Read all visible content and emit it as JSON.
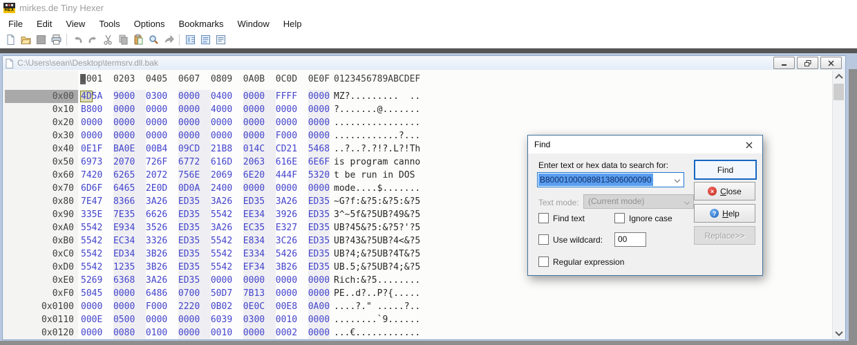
{
  "window": {
    "title": "mirkes.de Tiny Hexer",
    "app_icon": "hex-logo"
  },
  "menu": {
    "items": [
      "File",
      "Edit",
      "View",
      "Tools",
      "Options",
      "Bookmarks",
      "Window",
      "Help"
    ]
  },
  "toolbar": {
    "items": [
      {
        "name": "new-document",
        "interactable": true
      },
      {
        "name": "open-folder",
        "interactable": true
      },
      {
        "name": "save",
        "disabled": true,
        "interactable": false
      },
      {
        "name": "print",
        "interactable": true
      },
      {
        "sep": true
      },
      {
        "name": "undo",
        "disabled": true,
        "interactable": false
      },
      {
        "name": "redo",
        "disabled": true,
        "interactable": false
      },
      {
        "name": "cut",
        "disabled": true,
        "interactable": false
      },
      {
        "name": "copy",
        "disabled": true,
        "interactable": false
      },
      {
        "name": "paste",
        "interactable": true
      },
      {
        "name": "search",
        "interactable": true
      },
      {
        "name": "goto",
        "disabled": true,
        "interactable": false
      },
      {
        "sep": true
      },
      {
        "name": "bookmarks-panel",
        "interactable": true
      },
      {
        "name": "disk-window",
        "interactable": true
      },
      {
        "name": "script-list",
        "interactable": true
      }
    ]
  },
  "document": {
    "path": "C:\\Users\\sean\\Desktop\\termsrv.dll.bak",
    "window_buttons": [
      "minimize",
      "restore",
      "close"
    ]
  },
  "hex_view": {
    "column_header": "0001  0203  0405  0607  0809  0A0B  0C0D  0E0F",
    "ascii_header": "0123456789ABCDEF",
    "rows": [
      {
        "addr": "0x00",
        "selected": true,
        "cursor": "4D",
        "hex": "5A  9000  0300  0000  0400  0000  FFFF  0000",
        "ascii": "MZ?.........  .."
      },
      {
        "addr": "0x10",
        "hex": "B800  0000  0000  0000  4000  0000  0000  0000",
        "ascii": "?.......@......."
      },
      {
        "addr": "0x20",
        "hex": "0000  0000  0000  0000  0000  0000  0000  0000",
        "ascii": "................"
      },
      {
        "addr": "0x30",
        "hex": "0000  0000  0000  0000  0000  0000  F000  0000",
        "ascii": "............?..."
      },
      {
        "addr": "0x40",
        "hex": "0E1F  BA0E  00B4  09CD  21B8  014C  CD21  5468",
        "ascii": "..?..?.?!?.L?!Th"
      },
      {
        "addr": "0x50",
        "hex": "6973  2070  726F  6772  616D  2063  616E  6E6F",
        "ascii": "is program canno"
      },
      {
        "addr": "0x60",
        "hex": "7420  6265  2072  756E  2069  6E20  444F  5320",
        "ascii": "t be run in DOS "
      },
      {
        "addr": "0x70",
        "hex": "6D6F  6465  2E0D  0D0A  2400  0000  0000  0000",
        "ascii": "mode....$......."
      },
      {
        "addr": "0x80",
        "hex": "7E47  8366  3A26  ED35  3A26  ED35  3A26  ED35",
        "ascii": "~G?f:&?5:&?5:&?5"
      },
      {
        "addr": "0x90",
        "hex": "335E  7E35  6626  ED35  5542  EE34  3926  ED35",
        "ascii": "3^~5f&?5UB?49&?5"
      },
      {
        "addr": "0xA0",
        "hex": "5542  E934  3526  ED35  3A26  EC35  E327  ED35",
        "ascii": "UB?45&?5:&?5?'?5"
      },
      {
        "addr": "0xB0",
        "hex": "5542  EC34  3326  ED35  5542  E834  3C26  ED35",
        "ascii": "UB?43&?5UB?4<&?5"
      },
      {
        "addr": "0xC0",
        "hex": "5542  ED34  3B26  ED35  5542  E334  5426  ED35",
        "ascii": "UB?4;&?5UB?4T&?5"
      },
      {
        "addr": "0xD0",
        "hex": "5542  1235  3B26  ED35  5542  EF34  3B26  ED35",
        "ascii": "UB.5;&?5UB?4;&?5"
      },
      {
        "addr": "0xE0",
        "hex": "5269  6368  3A26  ED35  0000  0000  0000  0000",
        "ascii": "Rich:&?5........"
      },
      {
        "addr": "0xF0",
        "hex": "5045  0000  6486  0700  50D7  7B13  0000  0000",
        "ascii": "PE..d?..P?{....."
      },
      {
        "addr": "0x0100",
        "hex": "0000  0000  F000  2220  0B02  0E0C  00E8  0A00",
        "ascii": "....?.\" .....?.."
      },
      {
        "addr": "0x0110",
        "hex": "000E  0500  0000  0000  6039  0300  0010  0000",
        "ascii": "........`9......"
      },
      {
        "addr": "0x0120",
        "hex": "0000  0080  0100  0000  0010  0000  0002  0000",
        "ascii": "...€............"
      }
    ]
  },
  "find_dialog": {
    "title": "Find",
    "close_icon": "×",
    "label": "Enter text or hex data to search for:",
    "search_value": "B80001000089813806000090",
    "text_mode_label": "Text mode:",
    "text_mode_value": "(Current mode)",
    "checkbox_find_text": "Find text",
    "checkbox_ignore_case": "Ignore case",
    "checkbox_use_wildcard": "Use wildcard:",
    "checkbox_regex": "Regular expression",
    "wildcard_value": "00",
    "button_find": "Find",
    "button_close": "Close",
    "button_help": "Help",
    "button_replace": "Replace>>",
    "colors": {
      "accent": "#1a76d2",
      "selection": "#5a9ef0",
      "close_icon": "#c22d22",
      "help_icon": "#1d61bd"
    }
  }
}
